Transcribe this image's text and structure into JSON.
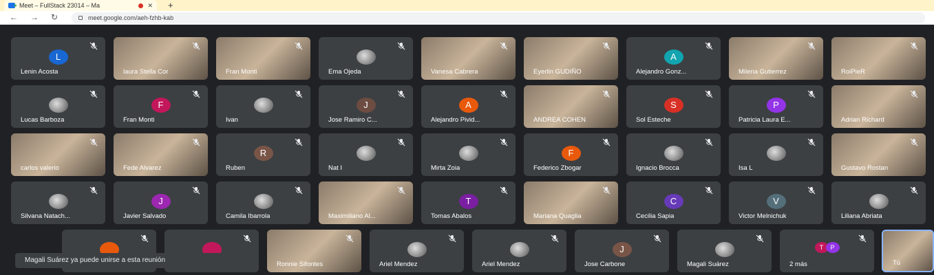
{
  "browser": {
    "tab_title": "Meet – FullStack 23014 – Ma",
    "tab_close": "✕",
    "new_tab": "+",
    "url": "meet.google.com/aeh-fzhb-kab",
    "back": "←",
    "forward": "→",
    "reload": "↻"
  },
  "participants": [
    {
      "name": "Lenin Acosta",
      "initial": "L",
      "color": "#1967d2",
      "video": false
    },
    {
      "name": "laura Stella Cor",
      "initial": "",
      "color": "",
      "video": true
    },
    {
      "name": "Fran Monti",
      "initial": "",
      "color": "",
      "video": true
    },
    {
      "name": "Ema Ojeda",
      "initial": "",
      "color": "",
      "video": false,
      "photo": true
    },
    {
      "name": "Vanesa Cabrera",
      "initial": "",
      "color": "",
      "video": true
    },
    {
      "name": "Eyerlin GUDIÑO",
      "initial": "",
      "color": "",
      "video": true
    },
    {
      "name": "Alejandro Gonz...",
      "initial": "A",
      "color": "#12a4af",
      "video": false
    },
    {
      "name": "Milena Gutierrez",
      "initial": "",
      "color": "",
      "video": true
    },
    {
      "name": "RoiPieR",
      "initial": "",
      "color": "",
      "video": true
    },
    {
      "name": "Lucas Barboza",
      "initial": "",
      "color": "",
      "video": false,
      "photo": true
    },
    {
      "name": "Fran Monti",
      "initial": "F",
      "color": "#c2185b",
      "video": false
    },
    {
      "name": "Ivan",
      "initial": "",
      "color": "",
      "video": false,
      "photo": true
    },
    {
      "name": "Jose Ramiro C...",
      "initial": "J",
      "color": "#6d4c41",
      "video": false
    },
    {
      "name": "Alejandro Pivid...",
      "initial": "A",
      "color": "#e8590c",
      "video": false
    },
    {
      "name": "ANDREA COHEN",
      "initial": "",
      "color": "",
      "video": true
    },
    {
      "name": "Sol Esteche",
      "initial": "S",
      "color": "#d93025",
      "video": false
    },
    {
      "name": "Patricia Laura E...",
      "initial": "P",
      "color": "#9334e6",
      "video": false
    },
    {
      "name": "Adrian Richard",
      "initial": "",
      "color": "",
      "video": true
    },
    {
      "name": "carlos valerio",
      "initial": "",
      "color": "",
      "video": true
    },
    {
      "name": "Fede Alvarez",
      "initial": "",
      "color": "",
      "video": true
    },
    {
      "name": "Ruben",
      "initial": "R",
      "color": "#795548",
      "video": false
    },
    {
      "name": "Nat I",
      "initial": "",
      "color": "",
      "video": false,
      "photo": true
    },
    {
      "name": "Mirta Zoia",
      "initial": "",
      "color": "",
      "video": false,
      "photo": true
    },
    {
      "name": "Federico Zbogar",
      "initial": "F",
      "color": "#e8590c",
      "video": false
    },
    {
      "name": "Ignacio Brocca",
      "initial": "",
      "color": "",
      "video": false,
      "photo": true
    },
    {
      "name": "Isa L",
      "initial": "",
      "color": "",
      "video": false,
      "photo": true
    },
    {
      "name": "Gustavo Rostan",
      "initial": "",
      "color": "",
      "video": true
    },
    {
      "name": "Silvana Natach...",
      "initial": "",
      "color": "",
      "video": false,
      "photo": true
    },
    {
      "name": "Javier Salvado",
      "initial": "J",
      "color": "#9c27b0",
      "video": false
    },
    {
      "name": "Camila Ibarrola",
      "initial": "",
      "color": "",
      "video": false,
      "photo": true
    },
    {
      "name": "Maximiliano Al...",
      "initial": "",
      "color": "",
      "video": true
    },
    {
      "name": "Tomas Abalos",
      "initial": "T",
      "color": "#7b1fa2",
      "video": false
    },
    {
      "name": "Mariana Quaglia",
      "initial": "",
      "color": "",
      "video": true
    },
    {
      "name": "Cecilia Sapia",
      "initial": "C",
      "color": "#673ab7",
      "video": false
    },
    {
      "name": "Victor Melnichuk",
      "initial": "V",
      "color": "#546e7a",
      "video": false
    },
    {
      "name": "Liliana Abriata",
      "initial": "",
      "color": "",
      "video": false,
      "photo": true
    },
    {
      "name": "",
      "initial": "",
      "color": "#e8590c",
      "video": false
    },
    {
      "name": "",
      "initial": "",
      "color": "#c2185b",
      "video": false
    },
    {
      "name": "Ronnie Sifontes",
      "initial": "",
      "color": "",
      "video": true
    },
    {
      "name": "Ariel Mendez",
      "initial": "",
      "color": "",
      "video": false,
      "photo": true
    },
    {
      "name": "Ariel Mendez",
      "initial": "",
      "color": "",
      "video": false,
      "photo": true
    },
    {
      "name": "Jose Carbone",
      "initial": "J",
      "color": "#795548",
      "video": false
    },
    {
      "name": "Magali Suárez",
      "initial": "",
      "color": "",
      "video": false,
      "photo": true
    },
    {
      "name": "2 más",
      "initial": "",
      "color": "",
      "video": false,
      "more": [
        "T",
        "P"
      ]
    },
    {
      "name": "Tú",
      "initial": "",
      "color": "",
      "video": true,
      "self": true
    }
  ],
  "toast": "Magali Suárez ya puede unirse a esta reunión"
}
